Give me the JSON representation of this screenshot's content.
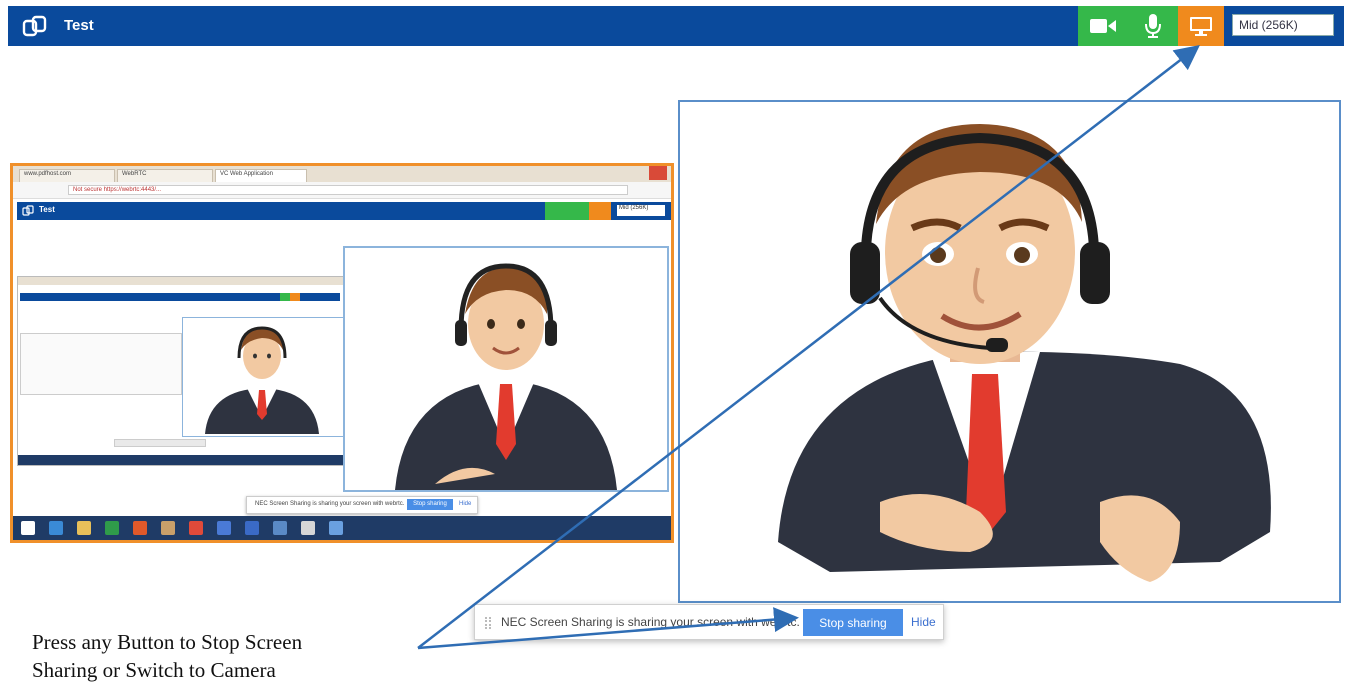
{
  "app": {
    "title": "Test",
    "quality": "Mid (256K)"
  },
  "colors": {
    "appbar": "#0a4a9c",
    "camera": "#35b84a",
    "mic": "#35b84a",
    "screen": "#f08a1d",
    "accent": "#4a8ee6"
  },
  "icons": {
    "logo": "app-logo-icon",
    "camera": "video-camera-icon",
    "mic": "microphone-icon",
    "screen": "screen-share-icon"
  },
  "mini": {
    "tabs": [
      "www.pdfhost.com",
      "WebRTC",
      "VC Web Application"
    ],
    "url": "Not secure  https://webrtc:4443/...",
    "app_title": "Test",
    "quality": "Mid (256K)",
    "share_text": "NEC Screen Sharing is sharing your screen with webrtc.",
    "stop_label": "Stop sharing",
    "hide_label": "Hide"
  },
  "sharebar": {
    "text": "NEC Screen Sharing is sharing your screen with webrtc.",
    "stop_label": "Stop sharing",
    "hide_label": "Hide"
  },
  "caption": {
    "line1": "Press any Button to Stop Screen",
    "line2": "Sharing or Switch to Camera"
  }
}
